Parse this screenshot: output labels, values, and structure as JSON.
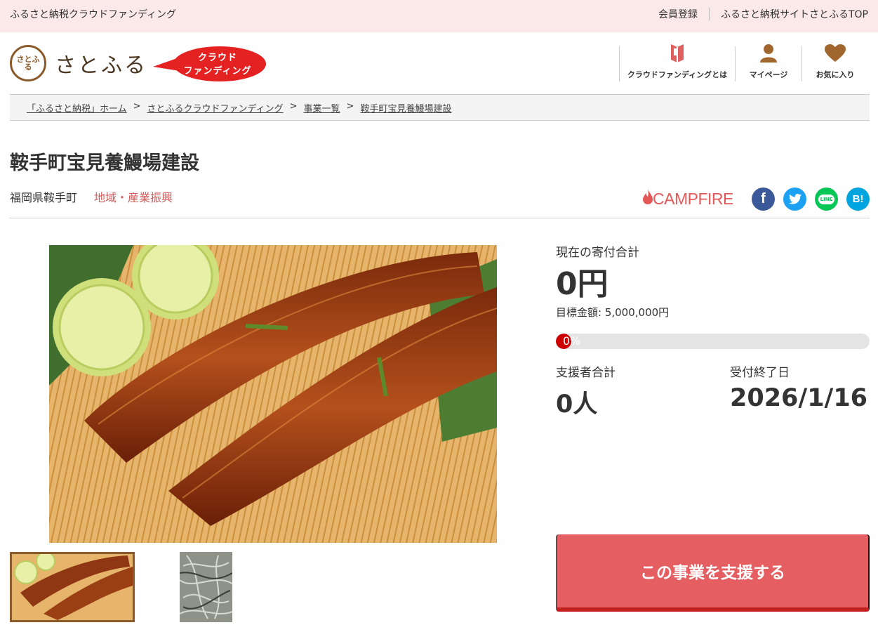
{
  "topbar": {
    "site_title": "ふるさと納税クラウドファンディング",
    "links": [
      "会員登録",
      "ふるさと納税サイトさとふるTOP"
    ]
  },
  "header": {
    "logo_seal_text": "さとふる",
    "logo_text": "さとふる",
    "badge_line1": "クラウド",
    "badge_line2": "ファンディング",
    "nav": [
      {
        "label": "クラウドファンディングとは",
        "icon": "book-icon"
      },
      {
        "label": "マイページ",
        "icon": "user-icon"
      },
      {
        "label": "お気に入り",
        "icon": "heart-icon"
      }
    ]
  },
  "breadcrumb": [
    "「ふるさと納税」ホーム",
    "さとふるクラウドファンディング",
    "事業一覧",
    "鞍手町宝見養鰻場建設"
  ],
  "project": {
    "title": "鞍手町宝見養鰻場建設",
    "location": "福岡県鞍手町",
    "category": "地域・産業振興",
    "partner": "CAMPFIRE",
    "share_icons": [
      "facebook-icon",
      "twitter-icon",
      "line-icon",
      "hatena-bookmark-icon"
    ],
    "line_label": "LINE",
    "hatena_label": "B!"
  },
  "stats": {
    "total_label": "現在の寄付合計",
    "total_value": "0円",
    "goal_text": "目標金額: 5,000,000円",
    "progress_percent": 0,
    "progress_label": "0%",
    "supporters_label": "支援者合計",
    "supporters_value": "0人",
    "deadline_label": "受付終了日",
    "deadline_value": "2026/1/16"
  },
  "cta": {
    "label": "この事業を支援する"
  },
  "colors": {
    "topbar_bg": "#fbe9ea",
    "accent": "#e45e62",
    "brand_brown": "#8b5a2b",
    "category": "#d45a5a",
    "campfire": "#e45858",
    "facebook": "#3b5998",
    "twitter": "#1da1f2",
    "line": "#06c755",
    "hatena": "#00a4de"
  }
}
